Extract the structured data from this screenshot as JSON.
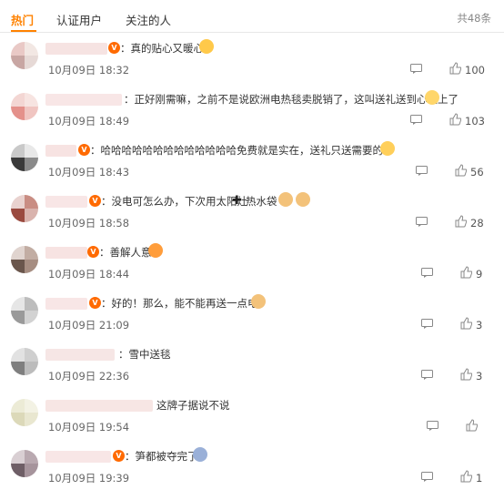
{
  "tabs": [
    {
      "label": "热门",
      "active": true
    },
    {
      "label": "认证用户",
      "active": false
    },
    {
      "label": "关注的人",
      "active": false
    }
  ],
  "total": "共48条",
  "accent_color": "#ff8200",
  "comments": [
    {
      "text": "：真的贴心又暖心",
      "time": "10月09日 18:32",
      "likes": "100"
    },
    {
      "text": "：正好刚需嘛，之前不是说欧洲电热毯卖脱销了，这叫送礼送到心坎上了",
      "time": "10月09日 18:49",
      "likes": "103"
    },
    {
      "text": "：哈哈哈哈哈哈哈哈哈哈哈哈哈免费就是实在，送礼只送需要的",
      "time": "10月09日 18:43",
      "likes": "56"
    },
    {
      "text_a": "：没电可怎么办，下次用太阳灶",
      "text_b": "热水袋",
      "time": "10月09日 18:58",
      "likes": "28"
    },
    {
      "text": "：善解人意",
      "time": "10月09日 18:44",
      "likes": "9"
    },
    {
      "text": "：好的！那么，能不能再送一点电！",
      "time": "10月09日 21:09",
      "likes": "3"
    },
    {
      "text": "：雪中送毯",
      "time": "10月09日 22:36",
      "likes": "3"
    },
    {
      "text": "这牌子据说不说",
      "time": "10月09日 19:54",
      "likes": ""
    },
    {
      "text": "：笋都被夺完了",
      "time": "10月09日 19:39",
      "likes": "1"
    }
  ]
}
